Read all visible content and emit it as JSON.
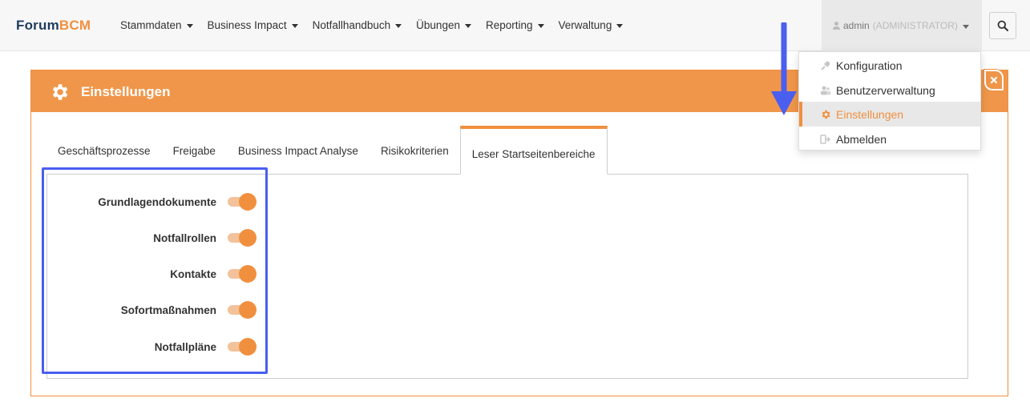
{
  "brand": {
    "part1": "Forum",
    "part2": "BCM"
  },
  "nav": {
    "items": [
      {
        "label": "Stammdaten"
      },
      {
        "label": "Business Impact"
      },
      {
        "label": "Notfallhandbuch"
      },
      {
        "label": "Übungen"
      },
      {
        "label": "Reporting"
      },
      {
        "label": "Verwaltung"
      }
    ]
  },
  "user": {
    "name": "admin",
    "role": "(ADMINISTRATOR)"
  },
  "user_menu": {
    "items": [
      {
        "label": "Konfiguration",
        "icon": "plug-icon"
      },
      {
        "label": "Benutzerverwaltung",
        "icon": "users-icon"
      },
      {
        "label": "Einstellungen",
        "icon": "gear-icon",
        "active": true
      },
      {
        "label": "Abmelden",
        "icon": "sign-out-icon"
      }
    ]
  },
  "panel": {
    "title": "Einstellungen"
  },
  "tabs": [
    {
      "label": "Geschäftsprozesse"
    },
    {
      "label": "Freigabe"
    },
    {
      "label": "Business Impact Analyse"
    },
    {
      "label": "Risikokriterien"
    },
    {
      "label": "Leser Startseitenbereiche",
      "active": true
    }
  ],
  "toggles": [
    {
      "label": "Grundlagendokumente",
      "on": true
    },
    {
      "label": "Notfallrollen",
      "on": true
    },
    {
      "label": "Kontakte",
      "on": true
    },
    {
      "label": "Sofortmaßnahmen",
      "on": true
    },
    {
      "label": "Notfallpläne",
      "on": true
    }
  ],
  "colors": {
    "accent": "#f0903e",
    "highlight": "#4a5ef0",
    "brand_dark": "#1f3b5c"
  }
}
